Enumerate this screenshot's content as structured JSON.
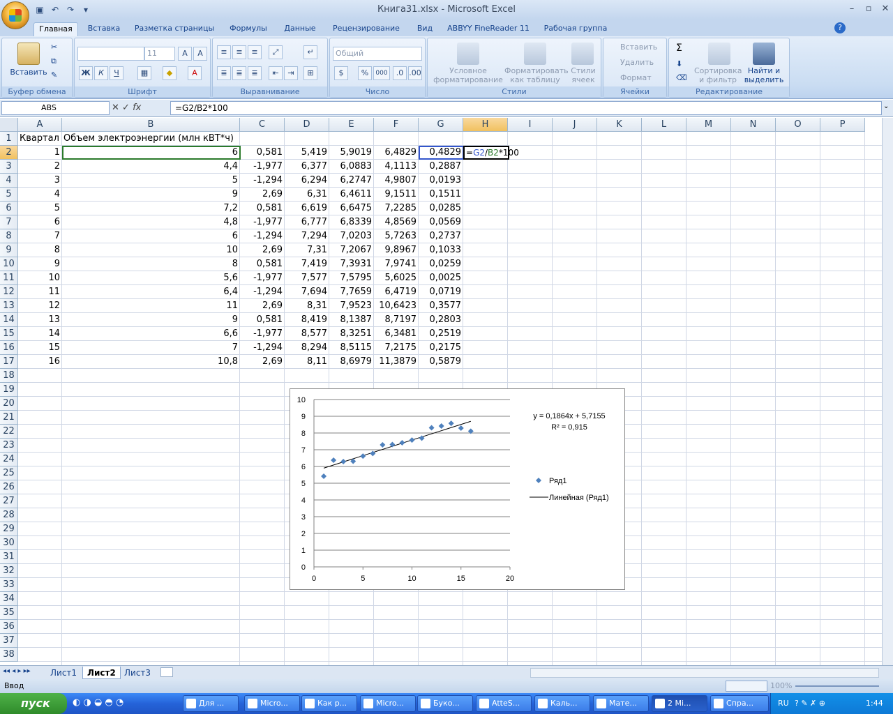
{
  "window": {
    "title": "Книга31.xlsx - Microsoft Excel"
  },
  "tabs": [
    "Главная",
    "Вставка",
    "Разметка страницы",
    "Формулы",
    "Данные",
    "Рецензирование",
    "Вид",
    "ABBYY FineReader 11",
    "Рабочая группа"
  ],
  "ribbon": {
    "clipboard": {
      "label": "Буфер обмена",
      "paste": "Вставить"
    },
    "font": {
      "label": "Шрифт",
      "size": "11",
      "bold": "Ж",
      "italic": "К",
      "underline": "Ч"
    },
    "alignment": {
      "label": "Выравнивание"
    },
    "number": {
      "label": "Число",
      "format": "Общий",
      "percent": "%",
      "thousands": "000"
    },
    "styles": {
      "label": "Стили",
      "cond": "Условное форматирование",
      "table": "Форматировать как таблицу",
      "cell": "Стили ячеек"
    },
    "cells": {
      "label": "Ячейки",
      "insert": "Вставить",
      "delete": "Удалить",
      "format": "Формат"
    },
    "editing": {
      "label": "Редактирование",
      "sort": "Сортировка и фильтр",
      "find": "Найти и выделить",
      "sum": "Σ"
    }
  },
  "formula_bar": {
    "name_box": "ABS",
    "fx": "fx",
    "formula": "=G2/B2*100"
  },
  "columns": [
    "A",
    "B",
    "C",
    "D",
    "E",
    "F",
    "G",
    "H",
    "I",
    "J",
    "K",
    "L",
    "M",
    "N",
    "O",
    "P"
  ],
  "header_row": {
    "a": "Квартал",
    "b": "Объем электроэнергии (млн кВТ*ч)"
  },
  "rows": [
    [
      "1",
      "6",
      "0,581",
      "5,419",
      "5,9019",
      "6,4829",
      "0,4829"
    ],
    [
      "2",
      "4,4",
      "-1,977",
      "6,377",
      "6,0883",
      "4,1113",
      "0,2887"
    ],
    [
      "3",
      "5",
      "-1,294",
      "6,294",
      "6,2747",
      "4,9807",
      "0,0193"
    ],
    [
      "4",
      "9",
      "2,69",
      "6,31",
      "6,4611",
      "9,1511",
      "0,1511"
    ],
    [
      "5",
      "7,2",
      "0,581",
      "6,619",
      "6,6475",
      "7,2285",
      "0,0285"
    ],
    [
      "6",
      "4,8",
      "-1,977",
      "6,777",
      "6,8339",
      "4,8569",
      "0,0569"
    ],
    [
      "7",
      "6",
      "-1,294",
      "7,294",
      "7,0203",
      "5,7263",
      "0,2737"
    ],
    [
      "8",
      "10",
      "2,69",
      "7,31",
      "7,2067",
      "9,8967",
      "0,1033"
    ],
    [
      "9",
      "8",
      "0,581",
      "7,419",
      "7,3931",
      "7,9741",
      "0,0259"
    ],
    [
      "10",
      "5,6",
      "-1,977",
      "7,577",
      "7,5795",
      "5,6025",
      "0,0025"
    ],
    [
      "11",
      "6,4",
      "-1,294",
      "7,694",
      "7,7659",
      "6,4719",
      "0,0719"
    ],
    [
      "12",
      "11",
      "2,69",
      "8,31",
      "7,9523",
      "10,6423",
      "0,3577"
    ],
    [
      "13",
      "9",
      "0,581",
      "8,419",
      "8,1387",
      "8,7197",
      "0,2803"
    ],
    [
      "14",
      "6,6",
      "-1,977",
      "8,577",
      "8,3251",
      "6,3481",
      "0,2519"
    ],
    [
      "15",
      "7",
      "-1,294",
      "8,294",
      "8,5115",
      "7,2175",
      "0,2175"
    ],
    [
      "16",
      "10,8",
      "2,69",
      "8,11",
      "8,6979",
      "11,3879",
      "0,5879"
    ]
  ],
  "editing_cell": {
    "formula": "=G2/B2*100",
    "part1": "=",
    "ref1": "G2",
    "op": "/",
    "ref2": "B2",
    "rest": "*100"
  },
  "row_numbers": [
    "1",
    "2",
    "3",
    "4",
    "5",
    "6",
    "7",
    "8",
    "9",
    "10",
    "11",
    "12",
    "13",
    "14",
    "15",
    "16",
    "17",
    "18",
    "19",
    "20",
    "21",
    "22",
    "23",
    "24",
    "25",
    "26",
    "27",
    "28",
    "29",
    "30",
    "31",
    "32",
    "33",
    "34",
    "35",
    "36",
    "37",
    "38"
  ],
  "sheets": [
    "Лист1",
    "Лист2",
    "Лист3"
  ],
  "status": {
    "mode": "Ввод",
    "zoom": "100%"
  },
  "taskbar": {
    "start": "пуск",
    "items": [
      "Для ...",
      "Micro...",
      "Как р...",
      "Micro...",
      "Буко...",
      "AtteS...",
      "Каль...",
      "Мате...",
      "2 Mi...",
      "Спра..."
    ],
    "lang": "RU",
    "time": "1:44"
  },
  "chart_data": {
    "type": "scatter",
    "x": [
      1,
      2,
      3,
      4,
      5,
      6,
      7,
      8,
      9,
      10,
      11,
      12,
      13,
      14,
      15,
      16
    ],
    "y": [
      5.419,
      6.377,
      6.294,
      6.31,
      6.619,
      6.777,
      7.294,
      7.31,
      7.419,
      7.577,
      7.694,
      8.31,
      8.419,
      8.577,
      8.294,
      8.11
    ],
    "series": [
      {
        "name": "Ряд1"
      }
    ],
    "trendline": {
      "name": "Линейная (Ряд1)",
      "slope": 0.1864,
      "intercept": 5.7155,
      "x_range": [
        1,
        16
      ]
    },
    "equation": "y = 0,1864x + 5,7155",
    "r2": "R² = 0,915",
    "xlim": [
      0,
      20
    ],
    "ylim": [
      0,
      10
    ],
    "x_ticks": [
      "0",
      "5",
      "10",
      "15",
      "20"
    ],
    "y_ticks": [
      "0",
      "1",
      "2",
      "3",
      "4",
      "5",
      "6",
      "7",
      "8",
      "9",
      "10"
    ],
    "grid": "horizontal",
    "legend": "right",
    "color": "#4f81bd"
  }
}
